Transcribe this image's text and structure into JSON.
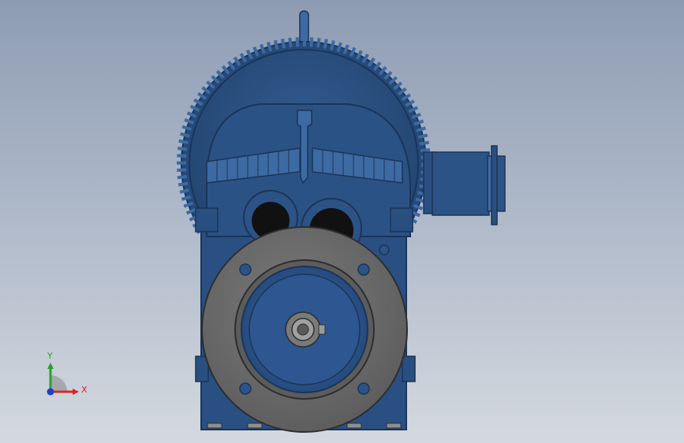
{
  "viewport": {
    "name": "graphics-area",
    "model_colors": {
      "housing": "#294f80",
      "housing_dark": "#1b3559",
      "housing_light": "#3d6aa3",
      "flange": "#6b6b6b",
      "flange_dark": "#3d3d3d",
      "shaft": "#9a9a9a"
    }
  },
  "triad": {
    "x_label": "X",
    "y_label": "Y",
    "x_color": "#d42a2a",
    "y_color": "#2aa02a",
    "z_color": "#1f3fc8"
  }
}
